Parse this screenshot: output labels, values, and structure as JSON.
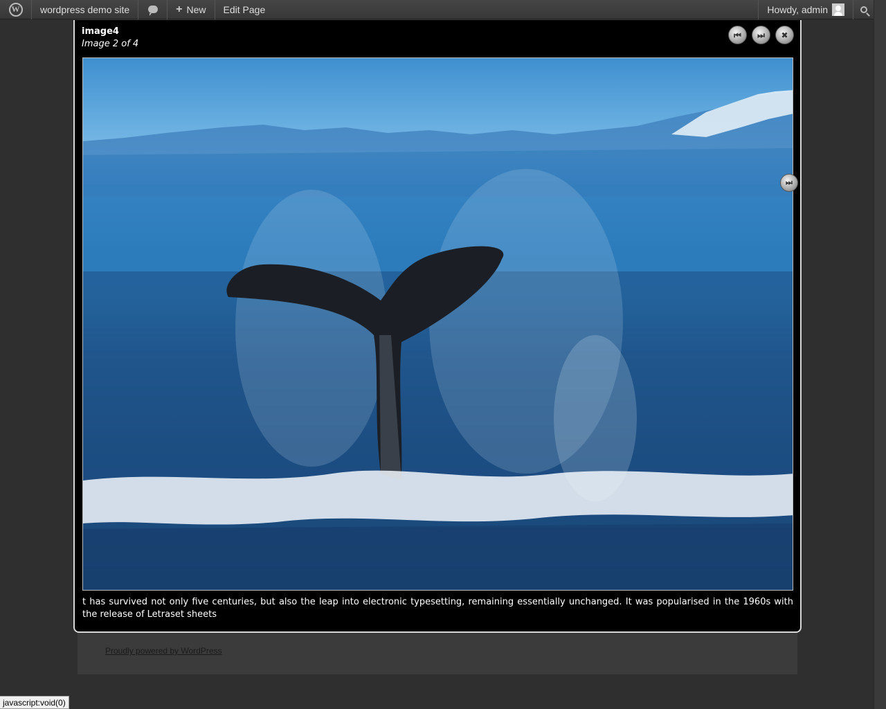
{
  "admin_bar": {
    "site_name": "wordpress demo site",
    "new_label": "New",
    "edit_label": "Edit Page",
    "greeting": "Howdy, admin"
  },
  "lightbox": {
    "title": "image4",
    "counter": "Image 2 of 4",
    "caption": "t has survived not only five centuries, but also the leap into electronic typesetting, remaining essentially unchanged. It was popularised in the 1960s with the release of Letraset sheets"
  },
  "footer": {
    "link": "Proudly powered by WordPress"
  },
  "status_bar": {
    "text": "javascript:void(0)"
  },
  "icons": {
    "wp_logo": "wordpress-logo-icon",
    "comments": "comment-bubble-icon",
    "new": "plus-icon",
    "avatar": "user-avatar-icon",
    "search": "search-icon",
    "prev": "previous-icon",
    "next": "next-icon",
    "close": "close-icon"
  },
  "colors": {
    "admin_bar_bg": "#464646",
    "page_bg": "#2f2f2f",
    "lightbox_bg": "#000000"
  }
}
